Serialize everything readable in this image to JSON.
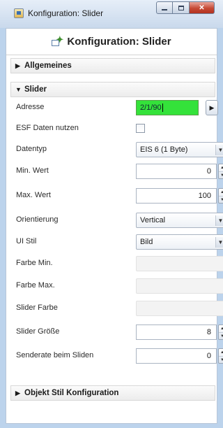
{
  "window": {
    "title": "Konfiguration: Slider",
    "controls": {
      "minimize": "minimize",
      "maximize": "maximize",
      "close": "close"
    }
  },
  "header": {
    "title": "Konfiguration: Slider",
    "icon": "config-icon"
  },
  "sections": {
    "general": {
      "label": "Allgemeines",
      "expanded": false
    },
    "slider": {
      "label": "Slider",
      "expanded": true
    },
    "style": {
      "label": "Objekt Stil Konfiguration",
      "expanded": false
    }
  },
  "fields": {
    "address": {
      "label": "Adresse",
      "value": "2/1/90"
    },
    "esf": {
      "label": "ESF Daten nutzen",
      "checked": false
    },
    "datatype": {
      "label": "Datentyp",
      "value": "EIS 6 (1 Byte)"
    },
    "min": {
      "label": "Min. Wert",
      "value": "0"
    },
    "max": {
      "label": "Max. Wert",
      "value": "100"
    },
    "orientation": {
      "label": "Orientierung",
      "value": "Vertical"
    },
    "ui_style": {
      "label": "UI Stil",
      "value": "Bild"
    },
    "color_min": {
      "label": "Farbe Min."
    },
    "color_max": {
      "label": "Farbe Max."
    },
    "slider_color": {
      "label": "Slider Farbe"
    },
    "slider_size": {
      "label": "Slider Größe",
      "value": "8"
    },
    "send_rate": {
      "label": "Senderate beim Sliden",
      "value": "0"
    }
  },
  "colors": {
    "address_highlight": "#34e23a",
    "close_button": "#c64a35"
  }
}
